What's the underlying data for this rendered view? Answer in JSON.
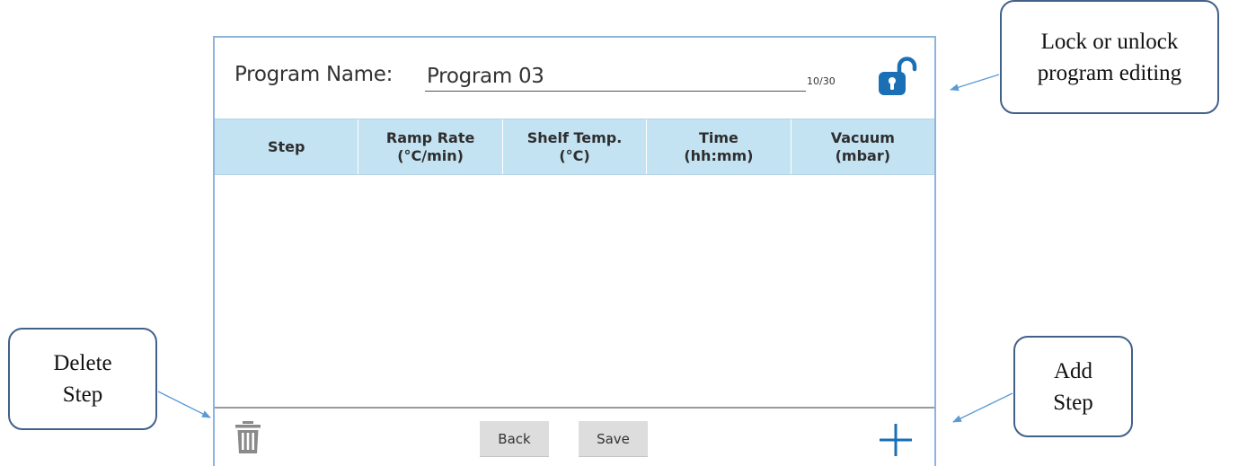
{
  "program": {
    "name_label": "Program Name:",
    "name_value": "Program 03",
    "char_count": "10/30"
  },
  "table": {
    "columns": [
      "Step",
      "Ramp Rate\n(°C/min)",
      "Shelf Temp.\n(°C)",
      "Time\n(hh:mm)",
      "Vacuum\n(mbar)"
    ],
    "rows": []
  },
  "footer": {
    "back_label": "Back",
    "save_label": "Save"
  },
  "icons": {
    "lock": "unlock-icon",
    "delete": "trash-icon",
    "add": "plus-icon"
  },
  "callouts": {
    "lock": "Lock or unlock\nprogram editing",
    "delete": "Delete\nStep",
    "add": "Add\nStep"
  },
  "colors": {
    "accent": "#1a6fb5",
    "header_bg": "#c3e3f3",
    "screen_border": "#8eb4dc",
    "button_bg": "#dddddd",
    "callout_border": "#41618a",
    "arrow": "#5b9bd5"
  }
}
